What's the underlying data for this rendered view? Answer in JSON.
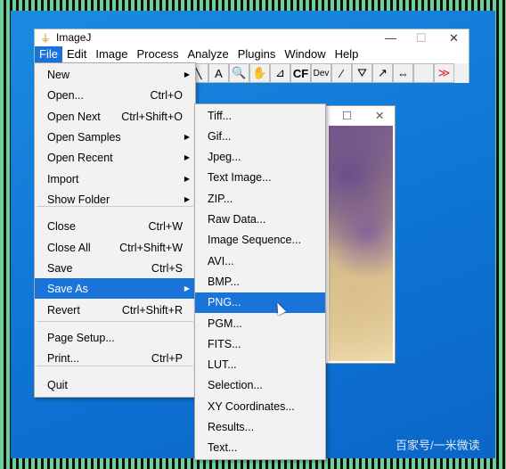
{
  "window": {
    "title": "ImageJ",
    "minimize": "—",
    "maximize": "☐",
    "close": "✕"
  },
  "menubar": [
    "File",
    "Edit",
    "Image",
    "Process",
    "Analyze",
    "Plugins",
    "Window",
    "Help"
  ],
  "toolbar": [
    {
      "icon": "line-icon",
      "glyph": "╲"
    },
    {
      "icon": "text-icon",
      "glyph": "A"
    },
    {
      "icon": "magnifier-icon",
      "glyph": "🔍"
    },
    {
      "icon": "hand-icon",
      "glyph": "✋"
    },
    {
      "icon": "dropper-icon",
      "glyph": "⊿"
    },
    {
      "icon": "cf-icon",
      "glyph": "CF"
    },
    {
      "icon": "dev-icon",
      "glyph": "Dev"
    },
    {
      "icon": "brush-icon",
      "glyph": "∕"
    },
    {
      "icon": "flood-icon",
      "glyph": "⛛"
    },
    {
      "icon": "arrow-icon",
      "glyph": "↗"
    },
    {
      "icon": "scroll-icon",
      "glyph": "⇔"
    },
    {
      "icon": "blank-icon",
      "glyph": ""
    },
    {
      "icon": "more-icon",
      "glyph": "≫"
    }
  ],
  "file_menu": [
    {
      "label": "New",
      "submenu": true
    },
    {
      "label": "Open...",
      "shortcut": "Ctrl+O"
    },
    {
      "label": "Open Next",
      "shortcut": "Ctrl+Shift+O"
    },
    {
      "label": "Open Samples",
      "submenu": true
    },
    {
      "label": "Open Recent",
      "submenu": true
    },
    {
      "label": "Import",
      "submenu": true
    },
    {
      "label": "Show Folder",
      "submenu": true
    },
    {
      "label": "Close",
      "shortcut": "Ctrl+W"
    },
    {
      "label": "Close All",
      "shortcut": "Ctrl+Shift+W"
    },
    {
      "label": "Save",
      "shortcut": "Ctrl+S"
    },
    {
      "label": "Save As",
      "submenu": true,
      "highlighted": true
    },
    {
      "label": "Revert",
      "shortcut": "Ctrl+Shift+R"
    },
    {
      "label": "Page Setup..."
    },
    {
      "label": "Print...",
      "shortcut": "Ctrl+P"
    },
    {
      "label": "Quit"
    }
  ],
  "save_as_menu": [
    "Tiff...",
    "Gif...",
    "Jpeg...",
    "Text Image...",
    "ZIP...",
    "Raw Data...",
    "Image Sequence...",
    "AVI...",
    "BMP...",
    "PNG...",
    "PGM...",
    "FITS...",
    "LUT...",
    "Selection...",
    "XY Coordinates...",
    "Results...",
    "Text..."
  ],
  "save_as_highlighted": "PNG...",
  "image_window": {
    "maximize": "☐",
    "close": "✕"
  },
  "watermark": "百家号/一米微读",
  "colors": {
    "accent": "#1a73d9",
    "desktop": "#0f77d6"
  }
}
